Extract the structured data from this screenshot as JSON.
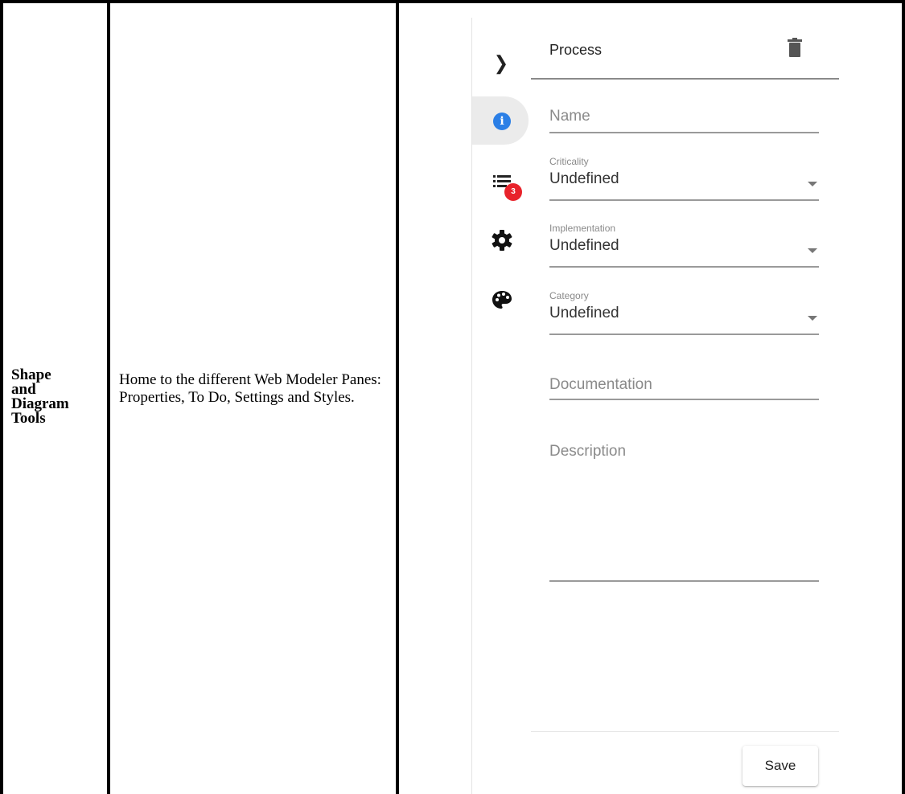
{
  "table": {
    "row_title": [
      "Shape",
      "and",
      "Diagram",
      "Tools"
    ],
    "row_description": "Home to the different Web Modeler Panes: Properties, To Do, Settings and Styles."
  },
  "pane": {
    "title": "Process",
    "todo_badge_count": "3",
    "fields": {
      "name": {
        "placeholder": "Name"
      },
      "criticality": {
        "label": "Criticality",
        "value": "Undefined"
      },
      "implementation": {
        "label": "Implementation",
        "value": "Undefined"
      },
      "category": {
        "label": "Category",
        "value": "Undefined"
      },
      "documentation": {
        "placeholder": "Documentation"
      },
      "description": {
        "placeholder": "Description"
      }
    },
    "save_label": "Save",
    "icons": {
      "collapse": "chevron-right-icon",
      "delete": "trash-icon",
      "properties": "info-icon",
      "todo": "list-icon",
      "settings": "gear-icon",
      "styles": "palette-icon"
    },
    "colors": {
      "info_accent": "#2b7fe6",
      "badge": "#e8232b"
    }
  }
}
